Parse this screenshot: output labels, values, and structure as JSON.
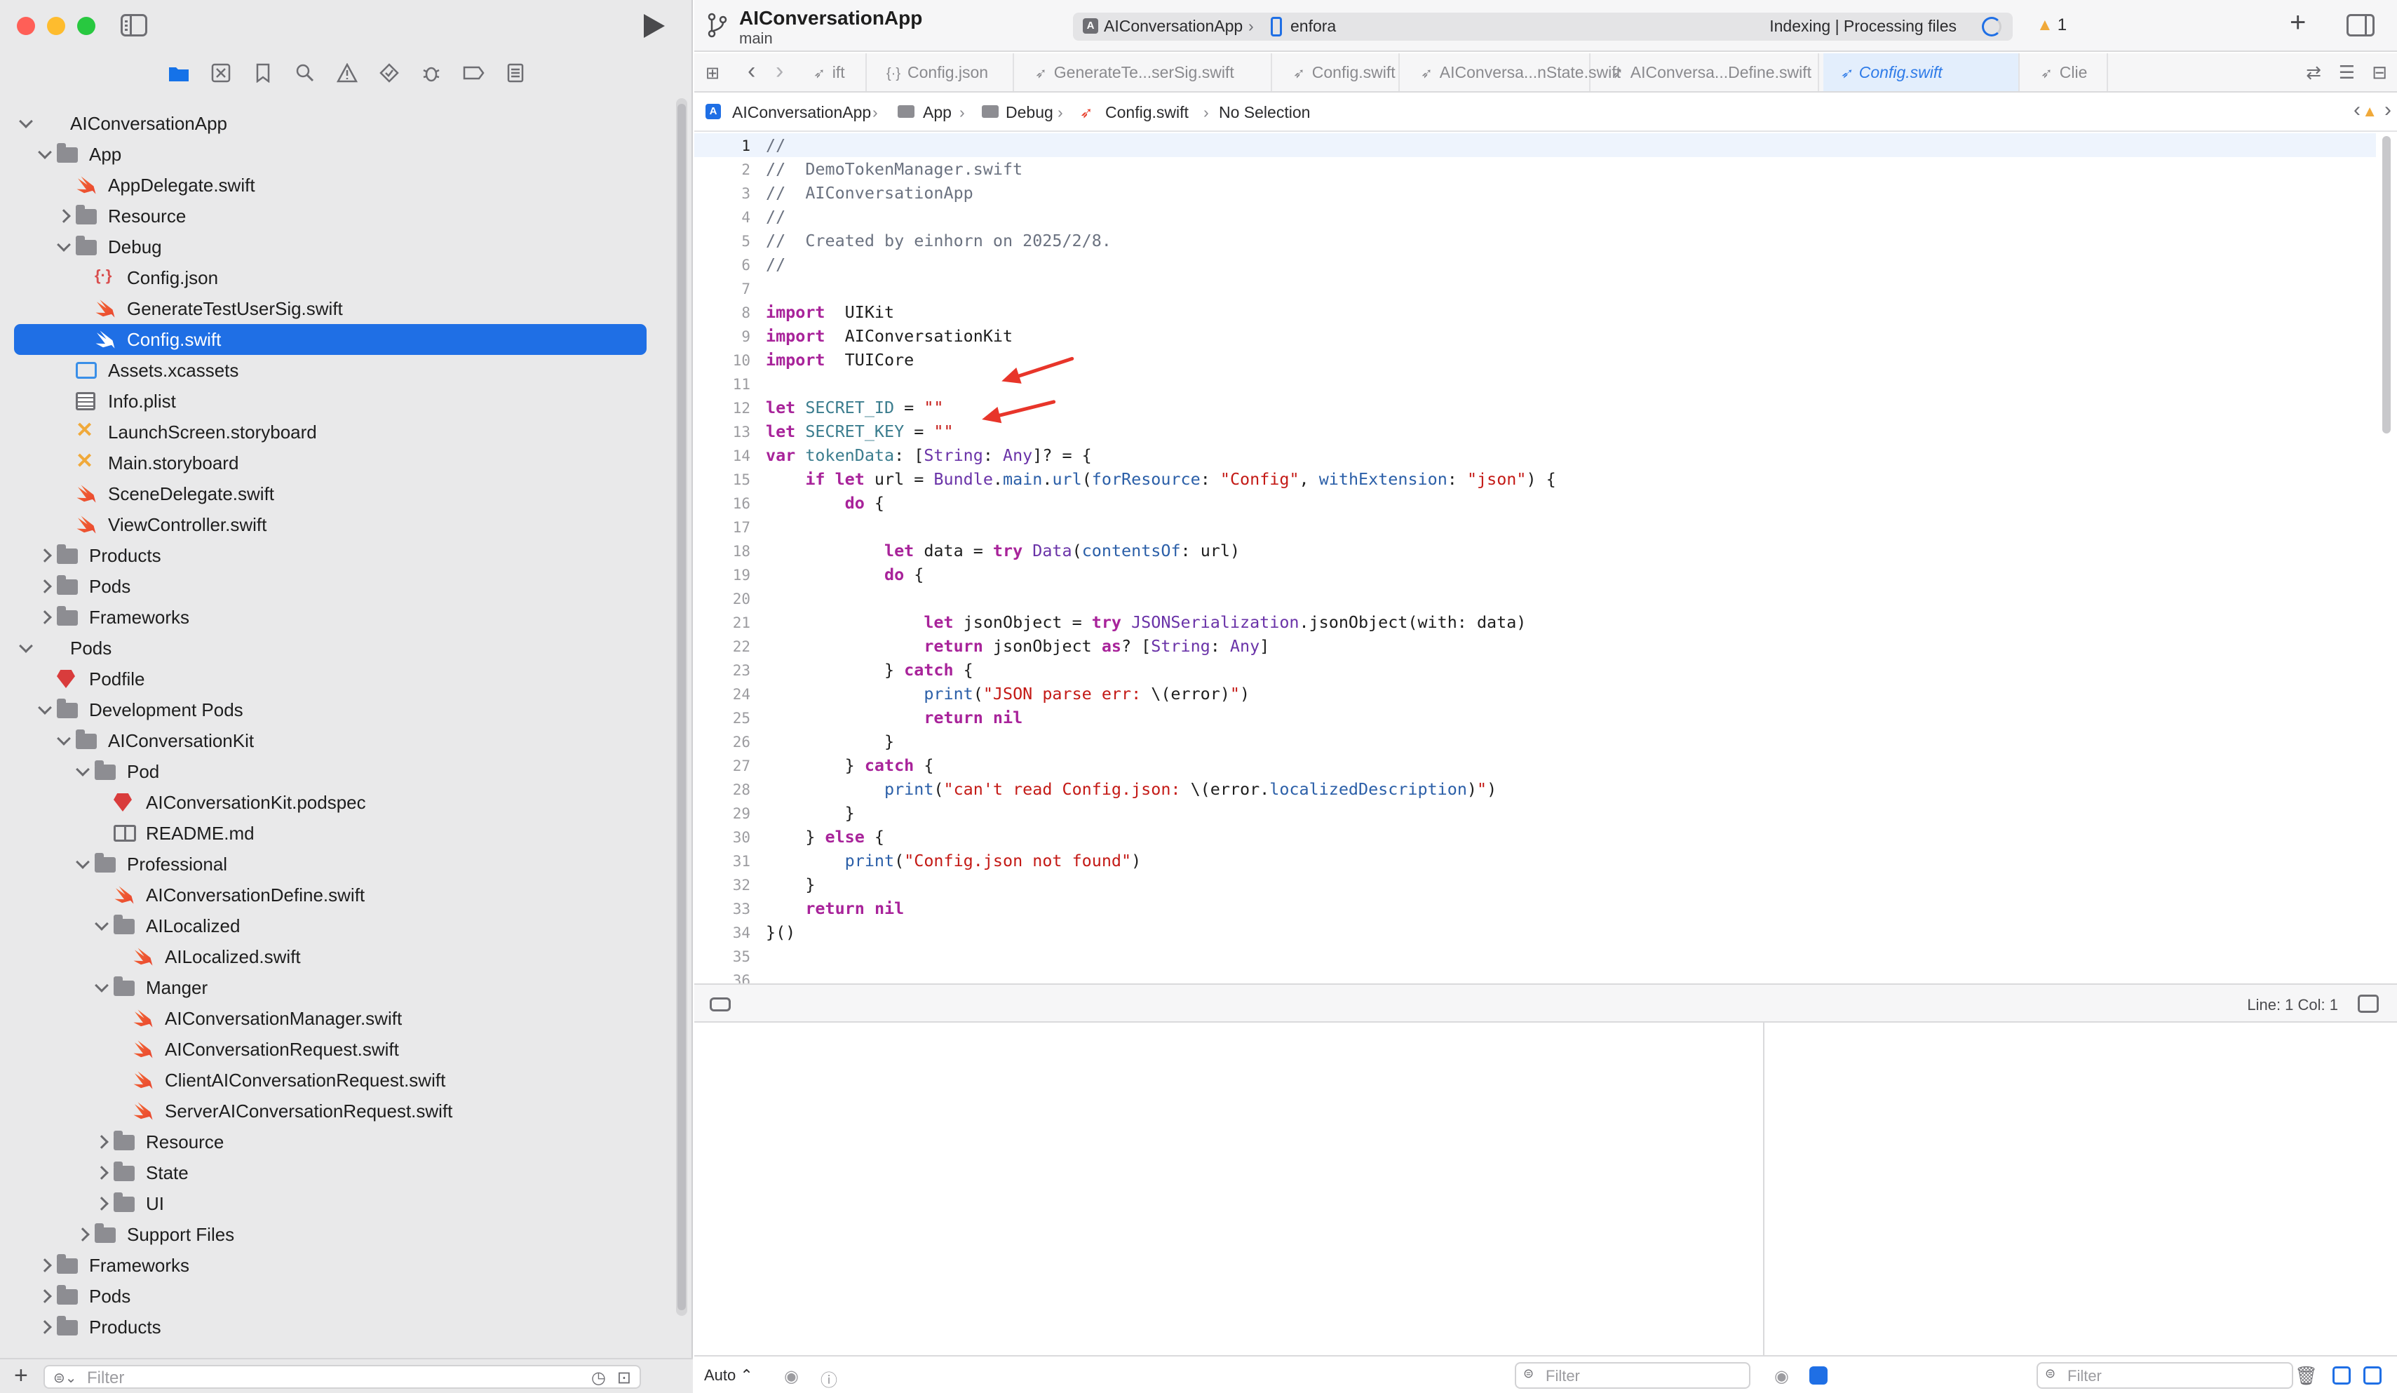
{
  "window": {
    "title": "AIConversationApp",
    "branch": "main"
  },
  "toolbar": {
    "scheme_target": "AIConversationApp",
    "device": "enfora",
    "status_text": "Indexing | Processing files",
    "warning_count": "1",
    "add_label": "+"
  },
  "navigator": {
    "tabs": [
      "folder-icon",
      "source-control-icon",
      "bookmark-icon",
      "search-icon",
      "warning-icon",
      "test-icon",
      "debug-icon",
      "breakpoint-icon",
      "report-icon"
    ],
    "filter_placeholder": "Filter",
    "rows": [
      {
        "label": "AIConversationApp",
        "icon": "project",
        "depth": 0,
        "chev": "open"
      },
      {
        "label": "App",
        "icon": "folder",
        "depth": 1,
        "chev": "open"
      },
      {
        "label": "AppDelegate.swift",
        "icon": "swift",
        "depth": 2,
        "chev": ""
      },
      {
        "label": "Resource",
        "icon": "folder",
        "depth": 2,
        "chev": "closed"
      },
      {
        "label": "Debug",
        "icon": "folder",
        "depth": 2,
        "chev": "open"
      },
      {
        "label": "Config.json",
        "icon": "json",
        "depth": 3,
        "chev": ""
      },
      {
        "label": "GenerateTestUserSig.swift",
        "icon": "swift",
        "depth": 3,
        "chev": ""
      },
      {
        "label": "Config.swift",
        "icon": "swift",
        "depth": 3,
        "chev": "",
        "selected": true
      },
      {
        "label": "Assets.xcassets",
        "icon": "assets",
        "depth": 2,
        "chev": ""
      },
      {
        "label": "Info.plist",
        "icon": "plist",
        "depth": 2,
        "chev": ""
      },
      {
        "label": "LaunchScreen.storyboard",
        "icon": "storyboard",
        "depth": 2,
        "chev": ""
      },
      {
        "label": "Main.storyboard",
        "icon": "storyboard",
        "depth": 2,
        "chev": ""
      },
      {
        "label": "SceneDelegate.swift",
        "icon": "swift",
        "depth": 2,
        "chev": ""
      },
      {
        "label": "ViewController.swift",
        "icon": "swift",
        "depth": 2,
        "chev": ""
      },
      {
        "label": "Products",
        "icon": "folder",
        "depth": 1,
        "chev": "closed"
      },
      {
        "label": "Pods",
        "icon": "folder",
        "depth": 1,
        "chev": "closed"
      },
      {
        "label": "Frameworks",
        "icon": "folder",
        "depth": 1,
        "chev": "closed"
      },
      {
        "label": "Pods",
        "icon": "project",
        "depth": 0,
        "chev": "open"
      },
      {
        "label": "Podfile",
        "icon": "gem",
        "depth": 1,
        "chev": ""
      },
      {
        "label": "Development Pods",
        "icon": "folder",
        "depth": 1,
        "chev": "open"
      },
      {
        "label": "AIConversationKit",
        "icon": "folder",
        "depth": 2,
        "chev": "open"
      },
      {
        "label": "Pod",
        "icon": "folder",
        "depth": 3,
        "chev": "open"
      },
      {
        "label": "AIConversationKit.podspec",
        "icon": "gem",
        "depth": 4,
        "chev": ""
      },
      {
        "label": "README.md",
        "icon": "book",
        "depth": 4,
        "chev": ""
      },
      {
        "label": "Professional",
        "icon": "folder",
        "depth": 3,
        "chev": "open"
      },
      {
        "label": "AIConversationDefine.swift",
        "icon": "swift",
        "depth": 4,
        "chev": ""
      },
      {
        "label": "AILocalized",
        "icon": "folder",
        "depth": 4,
        "chev": "open"
      },
      {
        "label": "AILocalized.swift",
        "icon": "swift",
        "depth": 5,
        "chev": ""
      },
      {
        "label": "Manger",
        "icon": "folder",
        "depth": 4,
        "chev": "open"
      },
      {
        "label": "AIConversationManager.swift",
        "icon": "swift",
        "depth": 5,
        "chev": ""
      },
      {
        "label": "AIConversationRequest.swift",
        "icon": "swift",
        "depth": 5,
        "chev": ""
      },
      {
        "label": "ClientAIConversationRequest.swift",
        "icon": "swift",
        "depth": 5,
        "chev": ""
      },
      {
        "label": "ServerAIConversationRequest.swift",
        "icon": "swift",
        "depth": 5,
        "chev": ""
      },
      {
        "label": "Resource",
        "icon": "folder",
        "depth": 4,
        "chev": "closed"
      },
      {
        "label": "State",
        "icon": "folder",
        "depth": 4,
        "chev": "closed"
      },
      {
        "label": "UI",
        "icon": "folder",
        "depth": 4,
        "chev": "closed"
      },
      {
        "label": "Support Files",
        "icon": "folder",
        "depth": 3,
        "chev": "closed"
      },
      {
        "label": "Frameworks",
        "icon": "folder",
        "depth": 1,
        "chev": "closed"
      },
      {
        "label": "Pods",
        "icon": "folder",
        "depth": 1,
        "chev": "closed"
      },
      {
        "label": "Products",
        "icon": "folder",
        "depth": 1,
        "chev": "closed"
      }
    ]
  },
  "tabs": [
    {
      "label": "ift",
      "active": false
    },
    {
      "label": "Config.json",
      "active": false
    },
    {
      "label": "GenerateTe...serSig.swift",
      "active": false
    },
    {
      "label": "Config.swift",
      "active": false
    },
    {
      "label": "AIConversa...nState.swift",
      "active": false
    },
    {
      "label": "AIConversa...Define.swift",
      "active": false
    },
    {
      "label": "Config.swift",
      "active": true
    },
    {
      "label": "Clie",
      "active": false
    }
  ],
  "breadcrumb": [
    "AIConversationApp",
    "App",
    "Debug",
    "Config.swift",
    "No Selection"
  ],
  "code_lines": [
    [
      [
        "cm",
        "//"
      ]
    ],
    [
      [
        "cm",
        "//  DemoTokenManager.swift"
      ]
    ],
    [
      [
        "cm",
        "//  AIConversationApp"
      ]
    ],
    [
      [
        "cm",
        "//"
      ]
    ],
    [
      [
        "cm",
        "//  Created by einhorn on 2025/2/8."
      ]
    ],
    [
      [
        "cm",
        "//"
      ]
    ],
    [],
    [
      [
        "k",
        "import"
      ],
      [
        "",
        "  UIKit"
      ]
    ],
    [
      [
        "k",
        "import"
      ],
      [
        "",
        "  AIConversationKit"
      ]
    ],
    [
      [
        "k",
        "import"
      ],
      [
        "",
        "  TUICore"
      ]
    ],
    [],
    [
      [
        "k",
        "let"
      ],
      [
        "",
        " "
      ],
      [
        "p",
        "SECRET_ID"
      ],
      [
        "",
        " = "
      ],
      [
        "s",
        "\"\""
      ]
    ],
    [
      [
        "k",
        "let"
      ],
      [
        "",
        " "
      ],
      [
        "p",
        "SECRET_KEY"
      ],
      [
        "",
        " = "
      ],
      [
        "s",
        "\"\""
      ]
    ],
    [
      [
        "k",
        "var"
      ],
      [
        "",
        " "
      ],
      [
        "p",
        "tokenData"
      ],
      [
        "",
        ": ["
      ],
      [
        "t",
        "String"
      ],
      [
        "",
        ": "
      ],
      [
        "t",
        "Any"
      ],
      [
        "",
        "]? = {"
      ]
    ],
    [
      [
        "",
        "    "
      ],
      [
        "k",
        "if let"
      ],
      [
        "",
        " url = "
      ],
      [
        "t",
        "Bundle"
      ],
      [
        "",
        "."
      ],
      [
        "f",
        "main"
      ],
      [
        "",
        "."
      ],
      [
        "f",
        "url"
      ],
      [
        "",
        "("
      ],
      [
        "f",
        "forResource"
      ],
      [
        "",
        ": "
      ],
      [
        "s",
        "\"Config\""
      ],
      [
        "",
        ", "
      ],
      [
        "f",
        "withExtension"
      ],
      [
        "",
        ": "
      ],
      [
        "s",
        "\"json\""
      ],
      [
        "",
        ") {"
      ]
    ],
    [
      [
        "",
        "        "
      ],
      [
        "k",
        "do"
      ],
      [
        "",
        " {"
      ]
    ],
    [],
    [
      [
        "",
        "            "
      ],
      [
        "k",
        "let"
      ],
      [
        "",
        " data = "
      ],
      [
        "k",
        "try"
      ],
      [
        "",
        " "
      ],
      [
        "t",
        "Data"
      ],
      [
        "",
        "("
      ],
      [
        "f",
        "contentsOf"
      ],
      [
        "",
        ": url)"
      ]
    ],
    [
      [
        "",
        "            "
      ],
      [
        "k",
        "do"
      ],
      [
        "",
        " {"
      ]
    ],
    [],
    [
      [
        "",
        "                "
      ],
      [
        "k",
        "let"
      ],
      [
        "",
        " jsonObject = "
      ],
      [
        "k",
        "try"
      ],
      [
        "",
        " "
      ],
      [
        "t",
        "JSONSerialization"
      ],
      [
        "",
        ".jsonObject(with: data)"
      ]
    ],
    [
      [
        "",
        "                "
      ],
      [
        "k",
        "return"
      ],
      [
        "",
        " jsonObject "
      ],
      [
        "k",
        "as"
      ],
      [
        "",
        "? ["
      ],
      [
        "t",
        "String"
      ],
      [
        "",
        ": "
      ],
      [
        "t",
        "Any"
      ],
      [
        "",
        "]"
      ]
    ],
    [
      [
        "",
        "            } "
      ],
      [
        "k",
        "catch"
      ],
      [
        "",
        " {"
      ]
    ],
    [
      [
        "",
        "                "
      ],
      [
        "f",
        "print"
      ],
      [
        "",
        "("
      ],
      [
        "s",
        "\"JSON parse err: "
      ],
      [
        "",
        "\\(error)"
      ],
      [
        "s",
        "\""
      ],
      [
        "",
        ")"
      ]
    ],
    [
      [
        "",
        "                "
      ],
      [
        "k",
        "return"
      ],
      [
        "",
        " "
      ],
      [
        "k",
        "nil"
      ]
    ],
    [
      [
        "",
        "            }"
      ]
    ],
    [
      [
        "",
        "        } "
      ],
      [
        "k",
        "catch"
      ],
      [
        "",
        " {"
      ]
    ],
    [
      [
        "",
        "            "
      ],
      [
        "f",
        "print"
      ],
      [
        "",
        "("
      ],
      [
        "s",
        "\"can't read Config.json: "
      ],
      [
        "",
        "\\(error."
      ],
      [
        "f",
        "localizedDescription"
      ],
      [
        "",
        ")"
      ],
      [
        "s",
        "\""
      ],
      [
        "",
        ")"
      ]
    ],
    [
      [
        "",
        "        }"
      ]
    ],
    [
      [
        "",
        "    } "
      ],
      [
        "k",
        "else"
      ],
      [
        "",
        " {"
      ]
    ],
    [
      [
        "",
        "        "
      ],
      [
        "f",
        "print"
      ],
      [
        "",
        "("
      ],
      [
        "s",
        "\"Config.json not found\""
      ],
      [
        "",
        ")"
      ]
    ],
    [
      [
        "",
        "    }"
      ]
    ],
    [
      [
        "",
        "    "
      ],
      [
        "k",
        "return"
      ],
      [
        "",
        " "
      ],
      [
        "k",
        "nil"
      ]
    ],
    [
      [
        "",
        "}()"
      ]
    ],
    [],
    []
  ],
  "status": {
    "line_col": "Line: 1  Col: 1"
  },
  "debug": {
    "auto_label": "Auto ⌃",
    "filter_left": "Filter",
    "filter_right": "Filter"
  },
  "colors": {
    "accent": "#1f6fe5",
    "close": "#ff5f57",
    "minimize": "#febc2e",
    "zoom": "#28c840",
    "annotation_arrow": "#e8352a"
  }
}
